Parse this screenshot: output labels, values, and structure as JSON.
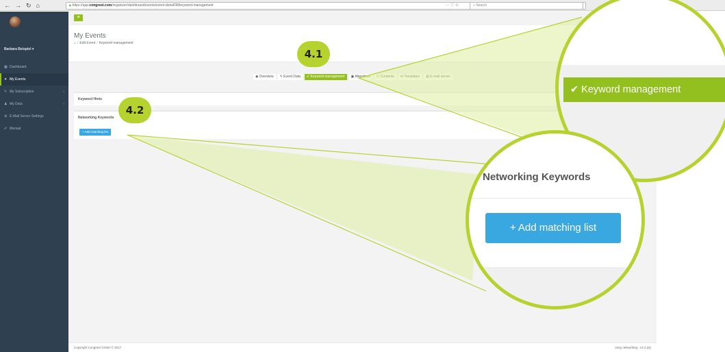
{
  "browser": {
    "url_prefix": "https://app.",
    "url_domain": "congreet.com",
    "url_path": "/organizer/dashboard/events/event-detail/38/keyword-management",
    "actions": "··· ♡ ☆",
    "search_placeholder": "Search"
  },
  "sidebar": {
    "user_name": "Barbara Beispiel ▾",
    "items": [
      {
        "icon": "▦",
        "label": "Dashboard"
      },
      {
        "icon": "✦",
        "label": "My Events"
      },
      {
        "icon": "✎",
        "label": "My Subscription",
        "chevron": "‹"
      },
      {
        "icon": "♟",
        "label": "My Data",
        "chevron": "‹"
      },
      {
        "icon": "⚙",
        "label": "E-Mail Server Settings"
      },
      {
        "icon": "✐",
        "label": "Manual"
      }
    ]
  },
  "main": {
    "menu_icon": "≡",
    "page_title": "My Events",
    "breadcrumb": {
      "home_icon": "⌂",
      "item1": "Edit Event",
      "item2": "Keyword management"
    },
    "tabs": [
      {
        "label": "◉ Overview"
      },
      {
        "label": "✎ Event Data"
      },
      {
        "label": "✔ Keyword management"
      },
      {
        "label": "▣ Attendees"
      },
      {
        "label": "☐ Contents"
      },
      {
        "label": "✉ Templates"
      },
      {
        "label": "▤ E-mail server"
      }
    ],
    "keyword_hints_title": "Keyword Hints",
    "networking_keywords_title": "Networking Keywords",
    "add_button": "+ Add matching list",
    "footer_copyright": "Copyright Congreet GmbH © 2017",
    "footer_version": "easy networking - v1.2.2/p"
  },
  "callouts": {
    "badge1": "4.1",
    "badge2": "4.2",
    "zoom1_label": "✔ Keyword management",
    "zoom2_title": "Networking Keywords",
    "zoom2_button": "+ Add matching list"
  },
  "colors": {
    "accent_green": "#93c01f",
    "callout_green": "#b6d22f",
    "button_blue": "#3aa8e0",
    "sidebar_bg": "#2f4050"
  }
}
